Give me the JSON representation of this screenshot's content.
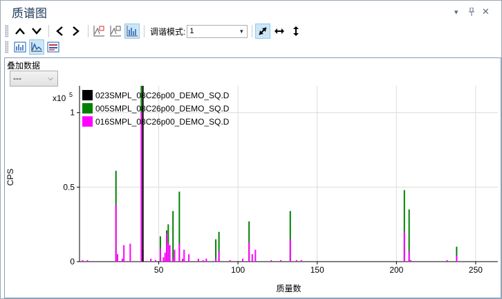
{
  "window": {
    "title": "质谱图",
    "controls": {
      "dropdown": "▾",
      "pin": "📌",
      "close": "✕"
    }
  },
  "toolbar": {
    "tune_mode_label": "调谐模式:",
    "tune_mode_value": "1"
  },
  "overlay": {
    "label": "叠加数据",
    "value": "---"
  },
  "chart_data": {
    "type": "bar",
    "title": "",
    "xlabel": "质量数",
    "ylabel": "CPS",
    "y_scale_label": "x10",
    "y_scale_exp": "5",
    "xlim": [
      0,
      264
    ],
    "ylim": [
      0,
      1.18
    ],
    "x_ticks": [
      50,
      100,
      150,
      200,
      250
    ],
    "y_ticks": [
      {
        "v": 0,
        "label": "0"
      },
      {
        "v": 0.5,
        "label": "0.5"
      },
      {
        "v": 1,
        "label": "1"
      }
    ],
    "grid": true,
    "legend_position": "top-left",
    "series": [
      {
        "name": "023SMPL_08C26p00_DEMO_SQ.D",
        "color": "#000000",
        "points": [
          [
            40,
            1.23
          ]
        ]
      },
      {
        "name": "005SMPL_08C26p00_DEMO_SQ.D",
        "color": "#008000",
        "points": [
          [
            23,
            0.61
          ],
          [
            39,
            1.23
          ],
          [
            51,
            0.17
          ],
          [
            55,
            0.21
          ],
          [
            56,
            0.25
          ],
          [
            59,
            0.34
          ],
          [
            63,
            0.47
          ],
          [
            86,
            0.15
          ],
          [
            88,
            0.2
          ],
          [
            107,
            0.27
          ],
          [
            133,
            0.34
          ],
          [
            205,
            0.48
          ],
          [
            208,
            0.35
          ],
          [
            238,
            0.1
          ]
        ]
      },
      {
        "name": "016SMPL_08C26p00_DEMO_SQ.D",
        "color": "#ff00ff",
        "points": [
          [
            2,
            0.01
          ],
          [
            5,
            0.01
          ],
          [
            23,
            0.38
          ],
          [
            24,
            0.05
          ],
          [
            27,
            0.02
          ],
          [
            28,
            0.11
          ],
          [
            32,
            0.12
          ],
          [
            39,
            1.0
          ],
          [
            40,
            0.08
          ],
          [
            45,
            0.02
          ],
          [
            48,
            0.01
          ],
          [
            51,
            0.09
          ],
          [
            53,
            0.03
          ],
          [
            54,
            0.06
          ],
          [
            55,
            0.19
          ],
          [
            56,
            0.12
          ],
          [
            57,
            0.11
          ],
          [
            59,
            0.02
          ],
          [
            60,
            0.08
          ],
          [
            63,
            0.12
          ],
          [
            65,
            0.02
          ],
          [
            66,
            0.08
          ],
          [
            69,
            0.05
          ],
          [
            75,
            0.02
          ],
          [
            78,
            0.01
          ],
          [
            80,
            0.02
          ],
          [
            86,
            0.02
          ],
          [
            88,
            0.07
          ],
          [
            95,
            0.01
          ],
          [
            103,
            0.02
          ],
          [
            107,
            0.13
          ],
          [
            109,
            0.05
          ],
          [
            111,
            0.08
          ],
          [
            121,
            0.01
          ],
          [
            127,
            0.01
          ],
          [
            133,
            0.15
          ],
          [
            137,
            0.01
          ],
          [
            140,
            0.01
          ],
          [
            205,
            0.2
          ],
          [
            208,
            0.07
          ],
          [
            209,
            0.01
          ],
          [
            232,
            0.01
          ],
          [
            238,
            0.04
          ]
        ]
      }
    ]
  }
}
